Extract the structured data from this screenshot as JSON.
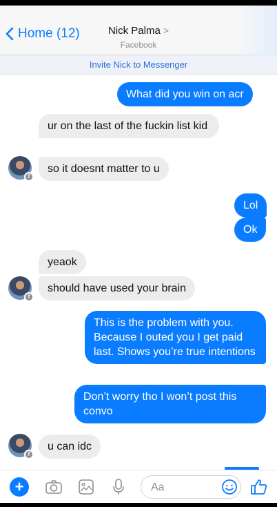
{
  "header": {
    "back_label": "Home (12)",
    "title": "Nick Palma",
    "title_chevron": ">",
    "subtitle": "Facebook"
  },
  "invite": {
    "label": "Invite Nick to Messenger"
  },
  "messages": [
    {
      "from": "me",
      "text": "What did you win on acr"
    },
    {
      "from": "nick",
      "text": "ur on the last of the fuckin list kid"
    },
    {
      "from": "nick",
      "text": "so it doesnt matter to u"
    },
    {
      "from": "me",
      "text": "Lol"
    },
    {
      "from": "me",
      "text": "Ok"
    },
    {
      "from": "nick",
      "text": "yeaok"
    },
    {
      "from": "nick",
      "text": "should have used your brain"
    },
    {
      "from": "me",
      "text": "This is the problem with you. Because I outed you I get paid last. Shows you’re true intentions"
    },
    {
      "from": "me",
      "text": "Don’t worry tho I won’t post this convo"
    },
    {
      "from": "nick",
      "text": "u can idc"
    }
  ],
  "composer": {
    "placeholder": "Aa",
    "icons": [
      "plus-icon",
      "camera-icon",
      "photo-icon",
      "microphone-icon",
      "emoji-icon",
      "like-icon"
    ]
  },
  "colors": {
    "accent": "#0a7cff",
    "incoming_bubble": "#ececee"
  }
}
